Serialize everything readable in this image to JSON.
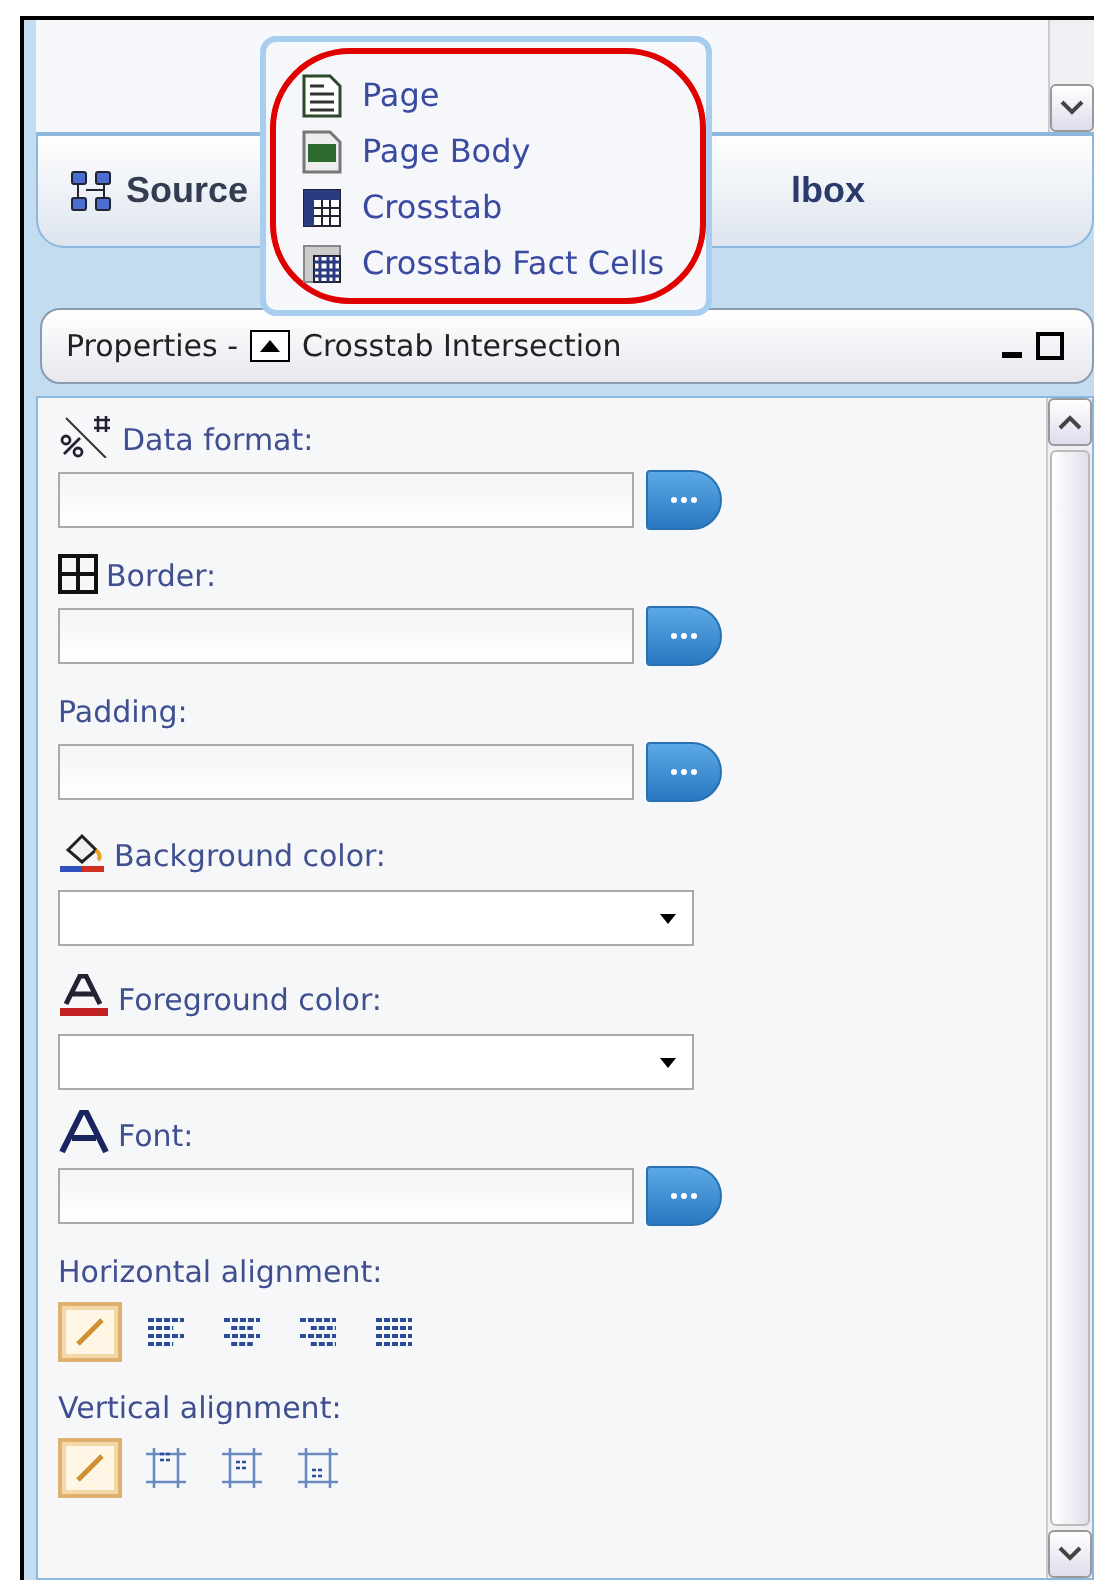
{
  "tabs": [
    {
      "label": "Source"
    },
    {
      "label": "lbox"
    }
  ],
  "popup_menu": {
    "items": [
      {
        "label": "Page",
        "kind": "page"
      },
      {
        "label": "Page Body",
        "kind": "body"
      },
      {
        "label": "Crosstab",
        "kind": "crosstab"
      },
      {
        "label": "Crosstab Fact Cells",
        "kind": "cells"
      }
    ]
  },
  "properties": {
    "title": "Properties -",
    "subtitle": "Crosstab Intersection",
    "fields": [
      {
        "kind": "format",
        "label": "Data format:"
      },
      {
        "kind": "border",
        "label": "Border:"
      },
      {
        "kind": "padding",
        "label": "Padding:"
      },
      {
        "kind": "background",
        "label": "Background color:"
      },
      {
        "kind": "foreground",
        "label": "Foreground color:"
      },
      {
        "kind": "font",
        "label": "Font:"
      },
      {
        "kind": "halign",
        "label": "Horizontal alignment:",
        "options": [
          {
            "kind": "default",
            "selected": true
          },
          {
            "kind": "left",
            "selected": false
          },
          {
            "kind": "center",
            "selected": false
          },
          {
            "kind": "right",
            "selected": false
          },
          {
            "kind": "justify",
            "selected": false
          }
        ]
      },
      {
        "kind": "valign",
        "label": "Vertical alignment:",
        "options": [
          {
            "kind": "default",
            "selected": true
          },
          {
            "kind": "top",
            "selected": false
          },
          {
            "kind": "middle",
            "selected": false
          },
          {
            "kind": "bottom",
            "selected": false
          }
        ]
      }
    ]
  }
}
